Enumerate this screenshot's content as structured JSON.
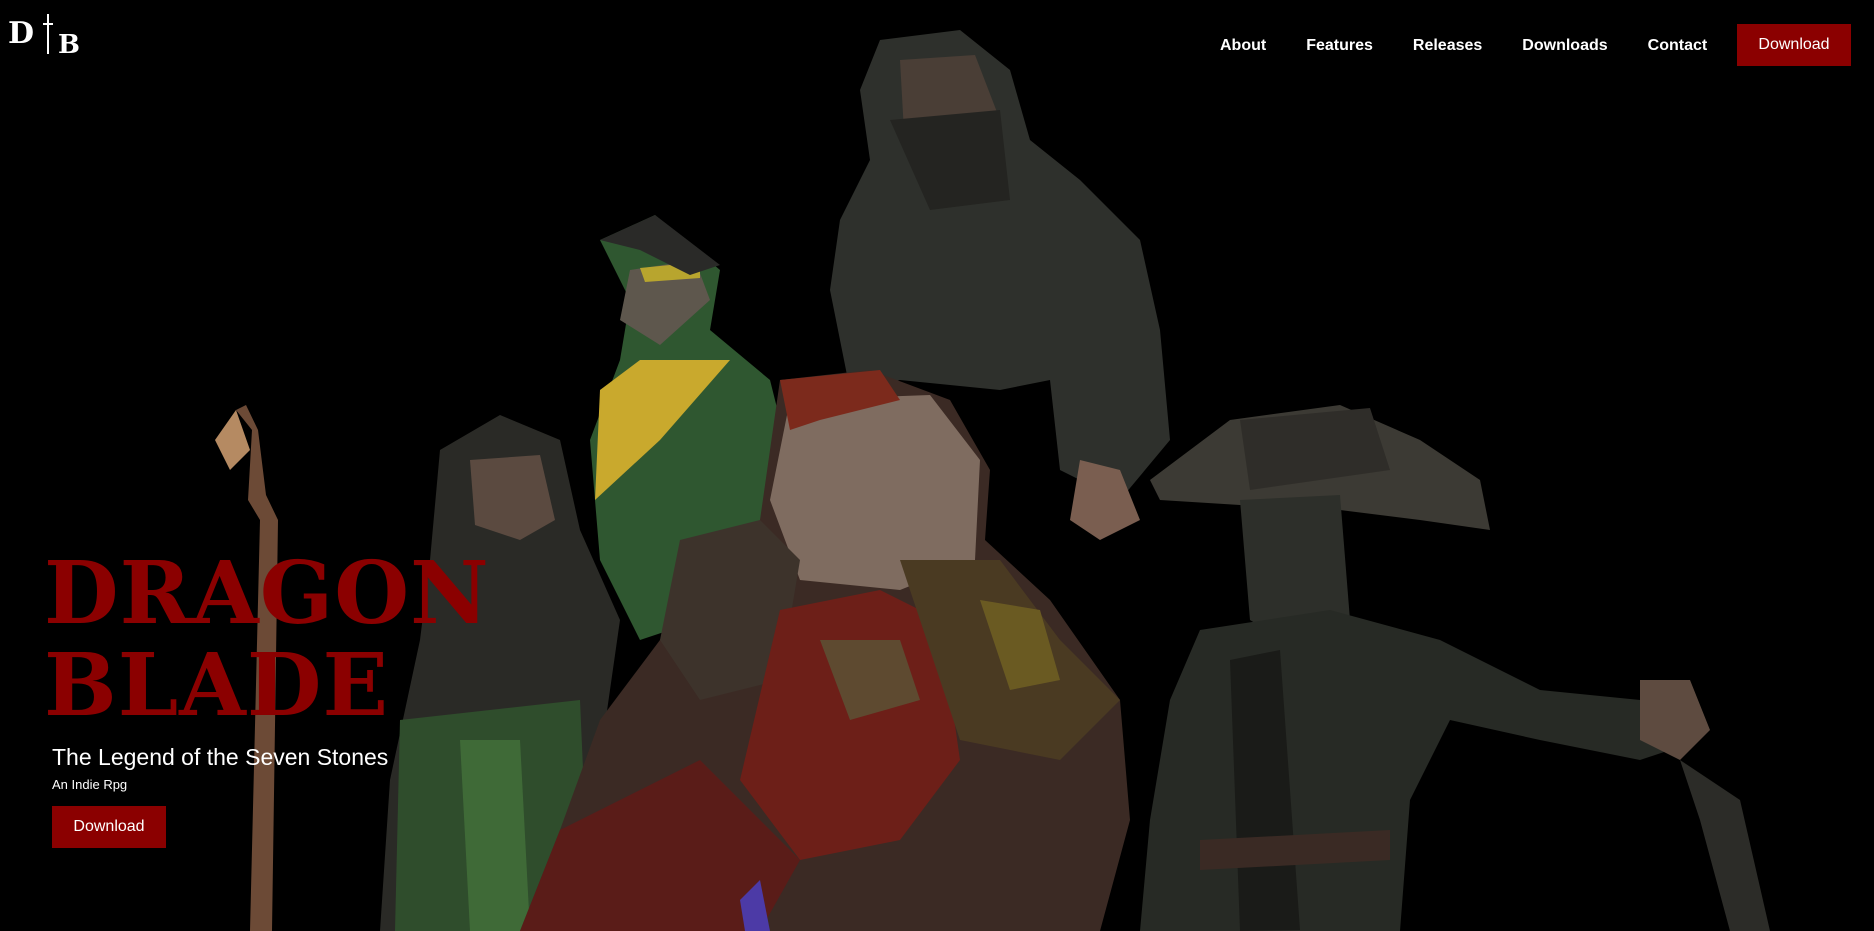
{
  "logo": {
    "letter_left": "D",
    "letter_right": "B"
  },
  "nav": {
    "links": [
      "About",
      "Features",
      "Releases",
      "Downloads",
      "Contact"
    ],
    "download_label": "Download"
  },
  "hero": {
    "title_line1": "DRAGON",
    "title_line2": "BLADE",
    "subtitle": "The Legend of the Seven Stones",
    "tagline": "An Indie Rpg",
    "download_label": "Download"
  },
  "colors": {
    "accent": "#8b0000",
    "background": "#000000",
    "text": "#ffffff"
  }
}
